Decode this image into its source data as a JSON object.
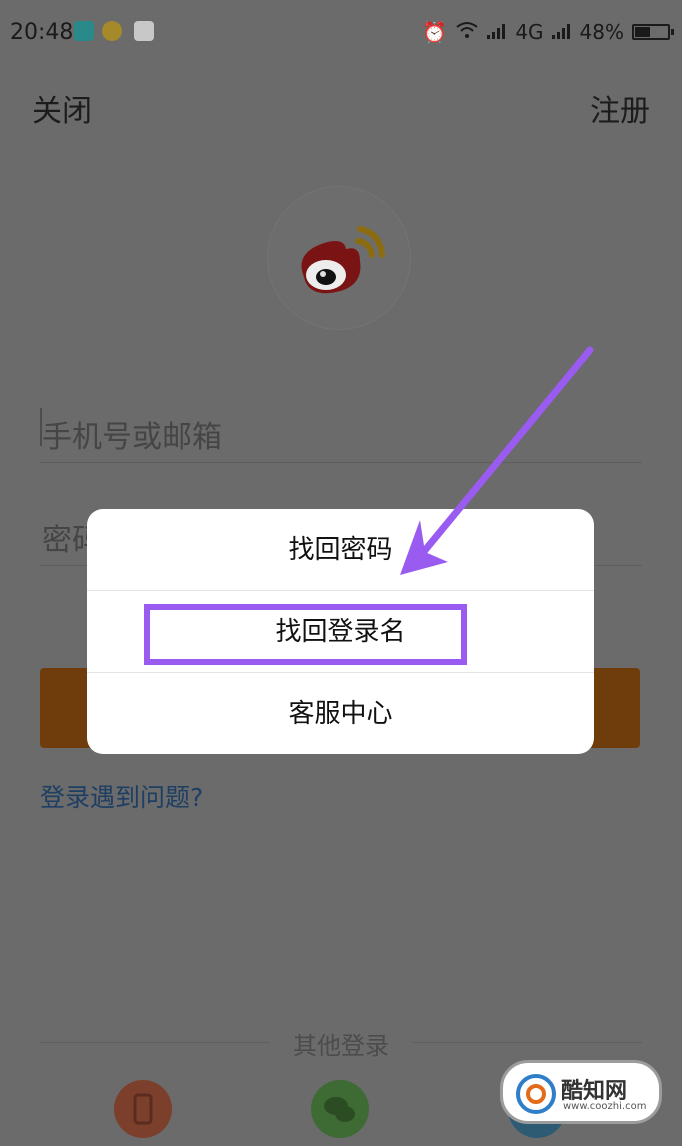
{
  "status_bar": {
    "time": "20:48",
    "network": "4G",
    "battery_percent": "48%",
    "battery_level": 0.48
  },
  "nav": {
    "close_label": "关闭",
    "register_label": "注册"
  },
  "form": {
    "account_placeholder": "手机号或邮箱",
    "password_placeholder": "密码"
  },
  "help_link": "登录遇到问题?",
  "other_login": {
    "title": "其他登录",
    "items": [
      "phone-login-icon",
      "wechat-login-icon",
      "qq-login-icon"
    ]
  },
  "dialog": {
    "items": [
      {
        "label": "找回密码"
      },
      {
        "label": "找回登录名"
      },
      {
        "label": "客服中心"
      }
    ]
  },
  "watermark": {
    "brand": "酷知网",
    "url": "www.coozhi.com"
  },
  "colors": {
    "overlay_bg": "#6b6b6b",
    "login_button": "#6e3d0b",
    "highlight": "#9a5bf0",
    "link": "#1e3e63"
  }
}
